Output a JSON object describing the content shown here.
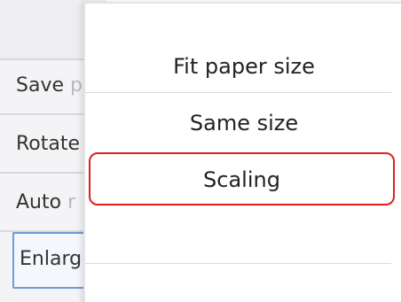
{
  "settings_list": {
    "items": [
      {
        "visible": "Save",
        "faded": " p"
      },
      {
        "visible": "Rotate",
        "faded": ""
      },
      {
        "visible": "Auto",
        "faded": " r"
      },
      {
        "visible": "Enlarg",
        "faded": ""
      }
    ],
    "selected_index": 3
  },
  "popup_menu": {
    "options": [
      {
        "label": "Fit paper size"
      },
      {
        "label": "Same size"
      },
      {
        "label": "Scaling"
      }
    ],
    "highlighted_option": "Scaling",
    "colors": {
      "highlight_border": "#e02020",
      "selection_border": "#6f9bd6"
    }
  }
}
